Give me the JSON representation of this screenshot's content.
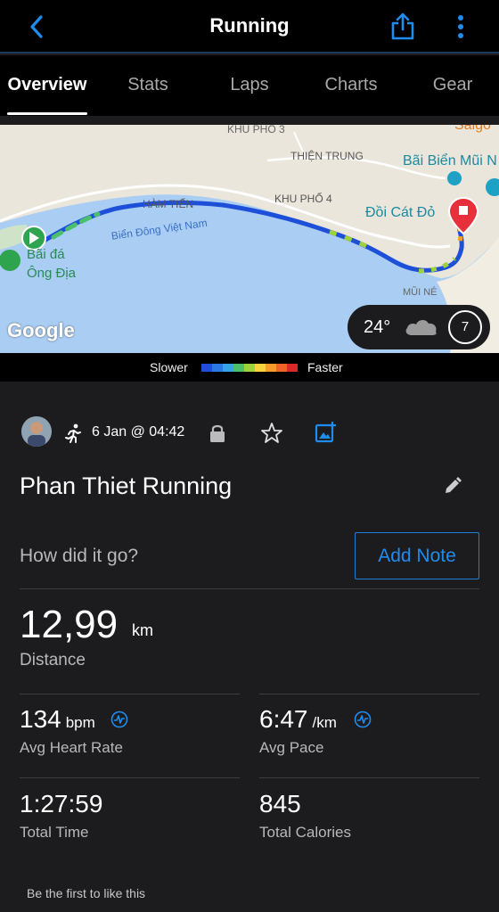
{
  "header": {
    "title": "Running"
  },
  "tabs": [
    {
      "label": "Overview",
      "active": true
    },
    {
      "label": "Stats"
    },
    {
      "label": "Laps"
    },
    {
      "label": "Charts"
    },
    {
      "label": "Gear"
    }
  ],
  "map": {
    "labels": {
      "khu_pho_3": "KHU PHỐ 3",
      "thien_trung": "THIỆN TRUNG",
      "bai_bien": "Bãi Biển Mũi N",
      "saigon": "Saigo",
      "ham_tien": "HÀM TIẾN",
      "khu_pho_4": "KHU PHỐ 4",
      "doi_cat_do": "Đồi Cát Đỏ",
      "bien_dong": "Biển Đông Việt Nam",
      "bai_da_1": "Bãi đá",
      "bai_da_2": "Ông Địa",
      "mui_ne": "MŨI NÉ",
      "google": "Google"
    },
    "weather": {
      "temperature": "24°",
      "wind": "7",
      "icon": "cloud-icon"
    }
  },
  "legend": {
    "slower": "Slower",
    "faster": "Faster",
    "colors": [
      "#1e4fd8",
      "#2a78e4",
      "#35a3e8",
      "#4cbf6a",
      "#9ed13b",
      "#f5d33b",
      "#f59b2a",
      "#f06228",
      "#d8282a"
    ]
  },
  "activity": {
    "date": "6 Jan @ 04:42",
    "name": "Phan Thiet Running",
    "note_prompt": "How did it go?",
    "add_note": "Add Note"
  },
  "distance": {
    "value": "12,99",
    "unit": "km",
    "label": "Distance"
  },
  "stats": {
    "heart_rate": {
      "value": "134",
      "unit": "bpm",
      "label": "Avg Heart Rate"
    },
    "pace": {
      "value": "6:47",
      "unit": "/km",
      "label": "Avg Pace"
    },
    "time": {
      "value": "1:27:59",
      "label": "Total Time"
    },
    "calories": {
      "value": "845",
      "label": "Total Calories"
    }
  },
  "social": {
    "likes": "Be the first to like this"
  },
  "colors": {
    "accent": "#1f8cf0",
    "background": "#1c1c1e",
    "header": "#000000"
  }
}
